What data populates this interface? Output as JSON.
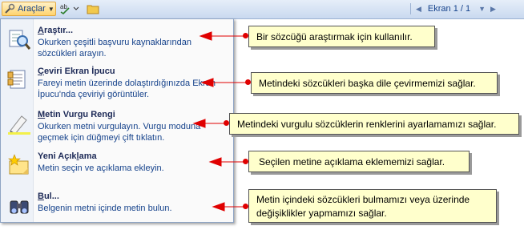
{
  "toolbar": {
    "tools_button": "Araçlar",
    "screen_label": "Ekran 1 / 1"
  },
  "menu": {
    "items": [
      {
        "title_u": "A",
        "title_rest": "raştır...",
        "desc": "Okurken çeşitli başvuru kaynaklarından sözcükleri arayın.",
        "icon": "research-icon"
      },
      {
        "title_u": "Ç",
        "title_rest": "eviri Ekran İpucu",
        "desc": "Fareyi metin üzerinde dolaştırdığınızda Ekran İpucu'nda çeviriyi görüntüler.",
        "icon": "translate-tooltip-icon"
      },
      {
        "title_u": "M",
        "title_rest": "etin Vurgu Rengi",
        "desc": "Okurken metni vurgulayın. Vurgu moduna geçmek için düğmeyi çift tıklatın.",
        "icon": "highlighter-icon"
      },
      {
        "title_pre": "Yeni Açık",
        "title_u": "l",
        "title_rest": "ama",
        "desc": "Metin seçin ve açıklama ekleyin.",
        "icon": "new-comment-icon"
      },
      {
        "title_u": "B",
        "title_rest": "ul...",
        "desc": "Belgenin metni içinde metin bulun.",
        "icon": "binoculars-icon"
      }
    ]
  },
  "callouts": [
    {
      "text": "Bir sözcüğü araştırmak için kullanılır."
    },
    {
      "text": "Metindeki sözcükleri başka dile çevirmemizi sağlar."
    },
    {
      "text": "Metindeki vurgulu sözcüklerin renklerini ayarlamamızı sağlar."
    },
    {
      "text": "Seçilen metine açıklama eklememizi sağlar."
    },
    {
      "line1": "Metin içindeki sözcükleri bulmamızı veya üzerinde",
      "line2": "değişiklikler yapmamızı sağlar."
    }
  ],
  "colors": {
    "arrow": "#e00000",
    "callout_bg": "#ffffcc",
    "menu_text": "#15428b"
  }
}
